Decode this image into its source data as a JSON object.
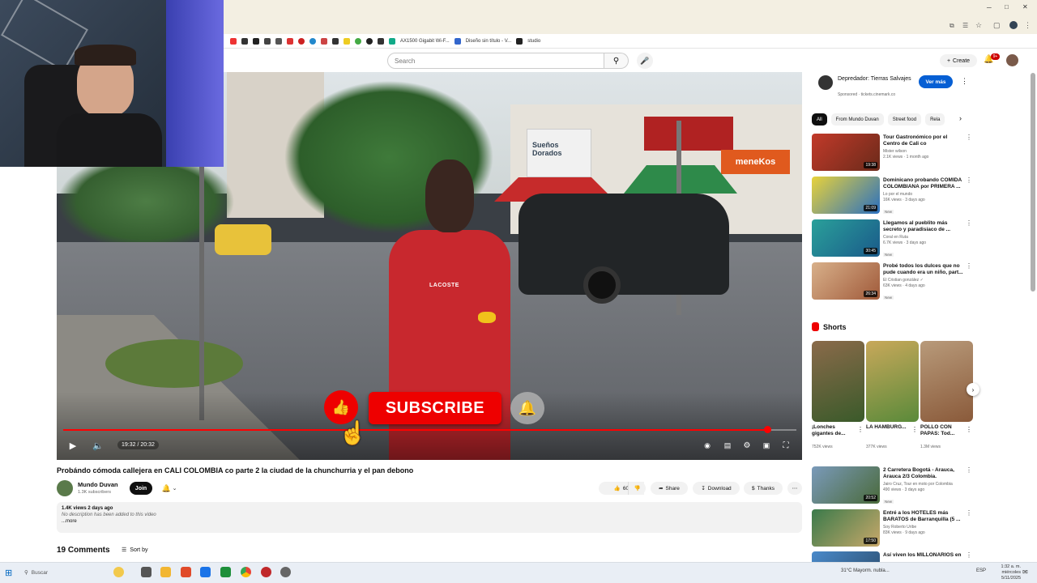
{
  "browser": {
    "bookmarks": [
      "AX1500 Gigabit Wi-F...",
      "Diseño sin título - V...",
      "studio"
    ],
    "window_controls": [
      "─",
      "□",
      "✕"
    ]
  },
  "header": {
    "search_placeholder": "Search",
    "create_label": "Create",
    "notification_count": "9+"
  },
  "player": {
    "time": "19:32 / 20:32",
    "progress": 0.96,
    "overlay_subscribe": "SUBSCRIBE",
    "shirt_text": "LACOSTE",
    "sign_suenos": "Sueños Dorados",
    "sign_meneko": "meneKos"
  },
  "video": {
    "title": "Probándo cómoda callejera en CALI COLOMBIA co parte 2 la ciudad de la chunchurria y el pan debono",
    "channel": "Mundo Duvan",
    "subscribers": "1.3K subscribers",
    "join_label": "Join",
    "likes": "60",
    "like_tooltip": "I like this",
    "share_label": "Share",
    "download_label": "Download",
    "thanks_label": "Thanks"
  },
  "description": {
    "meta": "1.4K views  2 days ago",
    "text": "No description has been added to this video",
    "more": "...more"
  },
  "comments": {
    "count": "19 Comments",
    "sort_label": "Sort by"
  },
  "ad": {
    "title": "Depredador: Tierras Salvajes",
    "sponsored": "Sponsored · tickets.cinemark.co",
    "button": "Ver más"
  },
  "chips": [
    "All",
    "From Mundo Duvan",
    "Street food",
    "Rela"
  ],
  "recommendations": [
    {
      "title": "Tour Gastronómico por el Centro de Cali co",
      "channel": "Mister wilson",
      "views": "2.1K views · 1 month ago",
      "duration": "19:38",
      "badge": ""
    },
    {
      "title": "Dominicano probando COMIDA COLOMBIANA por PRIMERA ...",
      "channel": "Lo por el mundo",
      "views": "16K views · 3 days ago",
      "duration": "21:09",
      "badge": "New"
    },
    {
      "title": "Llegamos al pueblito más secreto y paradisiaco de ...",
      "channel": "Coral en Ruta",
      "views": "6.7K views · 3 days ago",
      "duration": "30:45",
      "badge": "New"
    },
    {
      "title": "Probé todos los dulces que no pude cuando era un niño, part...",
      "channel": "El Cristian gonzález ✓",
      "views": "63K views · 4 days ago",
      "duration": "26:34",
      "badge": "New"
    }
  ],
  "shorts": {
    "heading": "Shorts",
    "items": [
      {
        "title": "¡Lonches gigantes de...",
        "views": "752K views"
      },
      {
        "title": "LA HAMBURG...",
        "views": "377K views"
      },
      {
        "title": "POLLO CON PAPAS: Tod...",
        "views": "1.3M views"
      }
    ]
  },
  "recommendations2": [
    {
      "title": "2 Carretera Bogotá - Arauca, Arauca 2/3 Colombia.",
      "channel": "Jairo Cruz, Tour en moto por Colombia",
      "views": "490 views · 3 days ago",
      "duration": "20:52",
      "badge": "New"
    },
    {
      "title": "Entré a los HOTELES más BARATOS de Barranquilla (5 ...",
      "channel": "Soy Roberto Uribe",
      "views": "83K views · 9 days ago",
      "duration": "17:50",
      "badge": ""
    },
    {
      "title": "Así viven los MILLONARIOS en",
      "channel": "",
      "views": "",
      "duration": "",
      "badge": ""
    }
  ],
  "taskbar": {
    "search": "Buscar",
    "weather": "31°C  Mayorm. nubla...",
    "time": "1:32 a. m.",
    "day": "miércoles",
    "date": "5/11/2025",
    "lang": "ESP"
  },
  "colors": {
    "accent": "#ff0000",
    "ad_button": "#065fd4"
  }
}
